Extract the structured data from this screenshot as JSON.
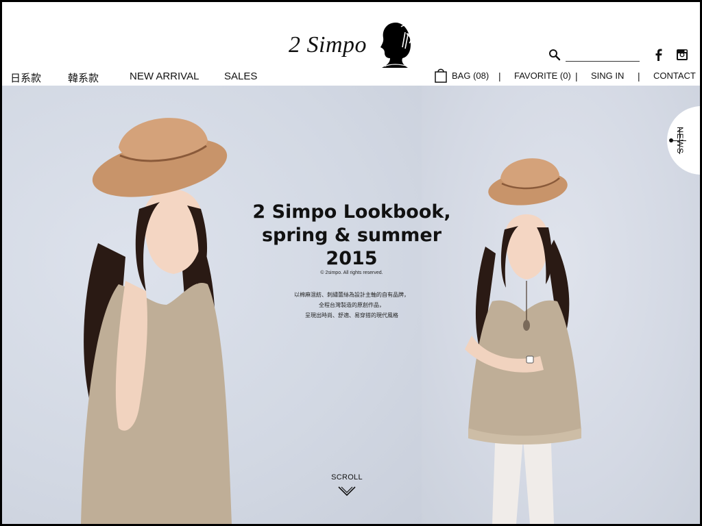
{
  "brand": {
    "logo_text": "2 Simpo"
  },
  "nav_left": [
    {
      "label": "日系款"
    },
    {
      "label": "韓系款"
    },
    {
      "label": "NEW ARRIVAL"
    },
    {
      "label": "SALES"
    }
  ],
  "nav_right": {
    "bag": "BAG (08)",
    "favorite": "FAVORITE (0)",
    "signin": "SING IN",
    "contact": "CONTACT",
    "separator": "|"
  },
  "search": {
    "value": "",
    "placeholder": ""
  },
  "social": {
    "facebook_icon": "facebook-icon",
    "instagram_icon": "instagram-icon"
  },
  "hero": {
    "title_lines": [
      "2 Simpo Lookbook,",
      "spring & summer",
      "2015"
    ],
    "copyright": "© 2simpo. All rights reserved.",
    "description_lines": [
      "以棉麻混紡、刺繡蕾絲為設計主軸的自有品牌，",
      "全程台灣製造的原創作品，",
      "呈現出時尚、舒適、易穿搭的現代風格"
    ],
    "scroll_label": "SCROLL"
  },
  "news_tab": {
    "label": "NEWS"
  },
  "colors": {
    "background": "#ffffff",
    "text": "#111111",
    "hero_bg": "#d4d9e4",
    "dress": "#bfae97",
    "hat": "#c8946a",
    "hair": "#2a1a14"
  }
}
